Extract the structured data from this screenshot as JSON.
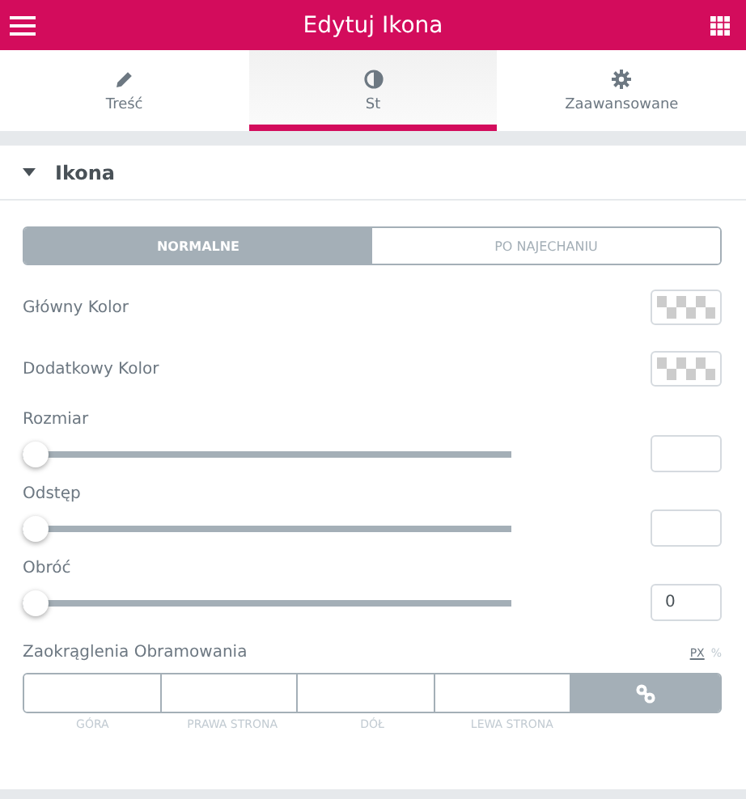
{
  "header": {
    "title": "Edytuj Ikona"
  },
  "tabs": [
    {
      "label": "Treść",
      "selected": false
    },
    {
      "label": "St",
      "selected": true
    },
    {
      "label": "Zaawansowane",
      "selected": false
    }
  ],
  "section": {
    "title": "Ikona",
    "expanded": true
  },
  "state_toggle": [
    {
      "label": "NORMALNE",
      "selected": true
    },
    {
      "label": "PO NAJECHANIU",
      "selected": false
    }
  ],
  "colors": [
    {
      "label": "Główny Kolor"
    },
    {
      "label": "Dodatkowy Kolor"
    }
  ],
  "sliders": [
    {
      "label": "Rozmiar",
      "level": 0
    },
    {
      "label": "Odstęp",
      "level": 0
    },
    {
      "label": "Obróć",
      "level": 0,
      "value": "0"
    }
  ],
  "border_radius": {
    "label": "Zaokrąglenia Obramowania",
    "units": [
      {
        "label": "PX",
        "selected": true
      },
      {
        "label": "%",
        "selected": false
      }
    ],
    "sides": [
      {
        "label": "GÓRA"
      },
      {
        "label": "PRAWA STRONA"
      },
      {
        "label": "DÓŁ"
      },
      {
        "label": "LEWA STRONA"
      }
    ],
    "linked": true
  }
}
